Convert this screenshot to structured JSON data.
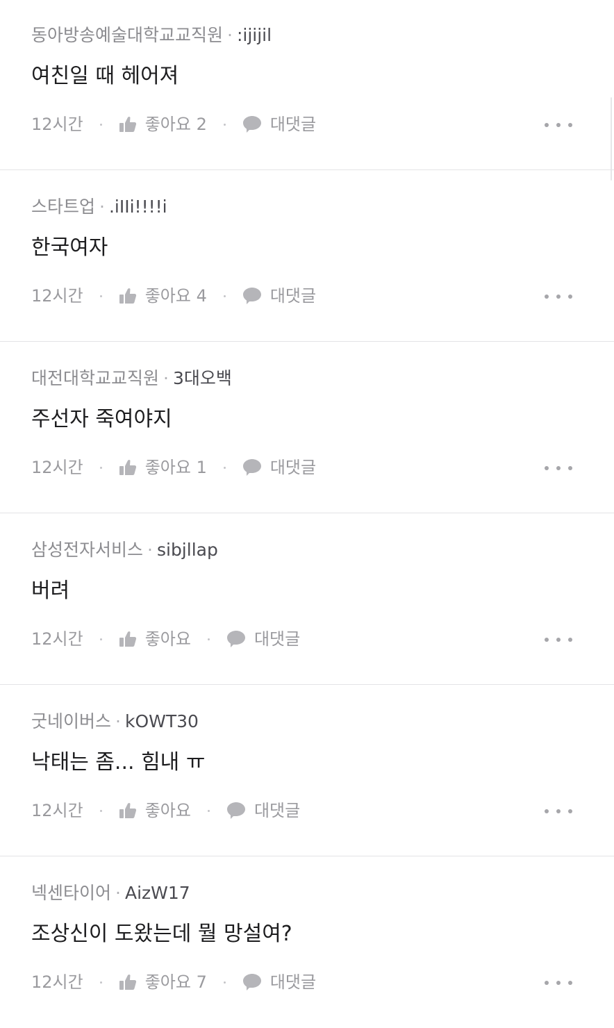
{
  "comments": [
    {
      "company": "동아방송예술대학교교직원",
      "separator": "·",
      "nickname": ":ijijil",
      "text": "여친일 때 헤어져",
      "time": "12시간",
      "like_label": "좋아요 2",
      "reply_label": "대댓글"
    },
    {
      "company": "스타트업",
      "separator": "·",
      "nickname": ".iIIi!!!!i",
      "text": "한국여자",
      "time": "12시간",
      "like_label": "좋아요 4",
      "reply_label": "대댓글"
    },
    {
      "company": "대전대학교교직원",
      "separator": "·",
      "nickname": "3대오백",
      "text": "주선자 죽여야지",
      "time": "12시간",
      "like_label": "좋아요 1",
      "reply_label": "대댓글"
    },
    {
      "company": "삼성전자서비스",
      "separator": "·",
      "nickname": "sibjllap",
      "text": "버려",
      "time": "12시간",
      "like_label": "좋아요",
      "reply_label": "대댓글"
    },
    {
      "company": "굿네이버스",
      "separator": "·",
      "nickname": "kOWT30",
      "text": "낙태는 좀... 힘내 ㅠ",
      "time": "12시간",
      "like_label": "좋아요",
      "reply_label": "대댓글"
    },
    {
      "company": "넥센타이어",
      "separator": "·",
      "nickname": "AizW17",
      "text": "조상신이 도왔는데 뭘 망설여?",
      "time": "12시간",
      "like_label": "좋아요 7",
      "reply_label": "대댓글"
    }
  ],
  "icons": {
    "like": "thumbs-up-icon",
    "reply": "speech-bubble-icon",
    "more": "more-dots-icon"
  },
  "colors": {
    "company_text": "#8c8c90",
    "nickname_text": "#4a4a50",
    "body_text": "#1d1d1f",
    "meta_text": "#9a9a9e",
    "divider": "#e3e3e6"
  }
}
